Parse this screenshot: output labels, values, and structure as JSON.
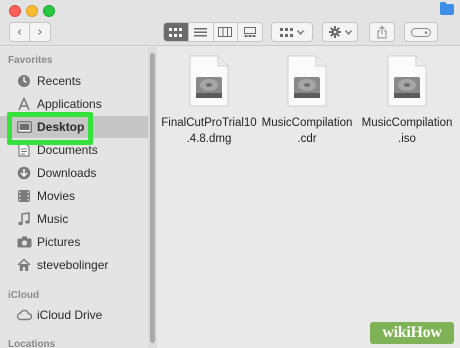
{
  "window": {
    "toolbar_icons": [
      "back-chevron-icon",
      "forward-chevron-icon",
      "icon-view-icon",
      "list-view-icon",
      "column-view-icon",
      "gallery-view-icon",
      "group-icon",
      "action-gear-icon",
      "share-icon",
      "tag-icon",
      "folder-icon"
    ],
    "back_glyph": "‹",
    "forward_glyph": "›"
  },
  "sidebar": {
    "favorites_title": "Favorites",
    "favorites": [
      {
        "label": "Recents",
        "icon": "clock-icon"
      },
      {
        "label": "Applications",
        "icon": "applications-icon"
      },
      {
        "label": "Desktop",
        "icon": "desktop-icon",
        "selected": true
      },
      {
        "label": "Documents",
        "icon": "document-icon"
      },
      {
        "label": "Downloads",
        "icon": "download-icon"
      },
      {
        "label": "Movies",
        "icon": "film-icon"
      },
      {
        "label": "Music",
        "icon": "music-note-icon"
      },
      {
        "label": "Pictures",
        "icon": "camera-icon"
      },
      {
        "label": "stevebolinger",
        "icon": "home-icon"
      }
    ],
    "icloud_title": "iCloud",
    "icloud": [
      {
        "label": "iCloud Drive",
        "icon": "cloud-icon"
      }
    ],
    "locations_title": "Locations"
  },
  "files": [
    {
      "line1": "FinalCutProTrial10",
      "line2": ".4.8.dmg",
      "icon": "disk-image-icon"
    },
    {
      "line1": "MusicCompilation",
      "line2": ".cdr",
      "icon": "disk-image-icon"
    },
    {
      "line1": "MusicCompilation",
      "line2": ".iso",
      "icon": "disk-image-icon"
    }
  ],
  "colors": {
    "highlight": "#35e23b",
    "watermark": "#7fb157"
  },
  "watermark": {
    "text": "wikiHow"
  }
}
